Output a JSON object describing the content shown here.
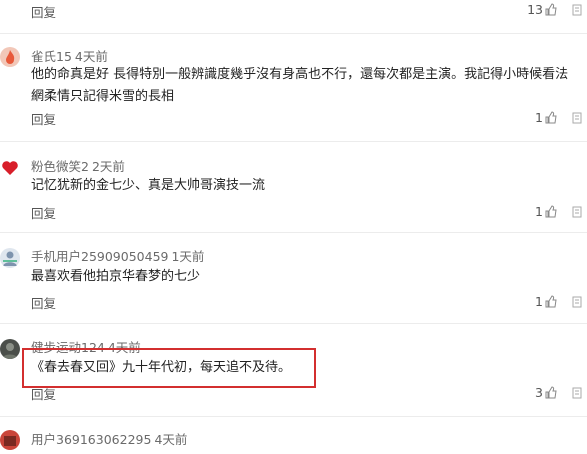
{
  "reply_label": "回复",
  "comments": [
    {
      "user": "",
      "time": "",
      "text": "",
      "likes": "13"
    },
    {
      "user": "雀氏15",
      "time": "4天前",
      "text": "他的命真是好 長得特別一般辨識度幾乎沒有身高也不行，還每次都是主演。我記得小時候看法網柔情只記得米雪的長相",
      "likes": "1"
    },
    {
      "user": "粉色微笑2",
      "time": "2天前",
      "text": "记忆犹新的金七少、真是大帅哥演技一流",
      "likes": "1"
    },
    {
      "user": "手机用户25909050459",
      "time": "1天前",
      "text": "最喜欢看他拍京华春梦的七少",
      "likes": "1"
    },
    {
      "user": "健步运动124",
      "time": "4天前",
      "text": "《春去春又回》九十年代初，每天追不及待。",
      "likes": "3"
    },
    {
      "user": "用户369163062295",
      "time": "4天前",
      "text": "",
      "likes": ""
    }
  ],
  "colors": {
    "highlight_border": "#d32f2f",
    "separator": "#ececec"
  }
}
